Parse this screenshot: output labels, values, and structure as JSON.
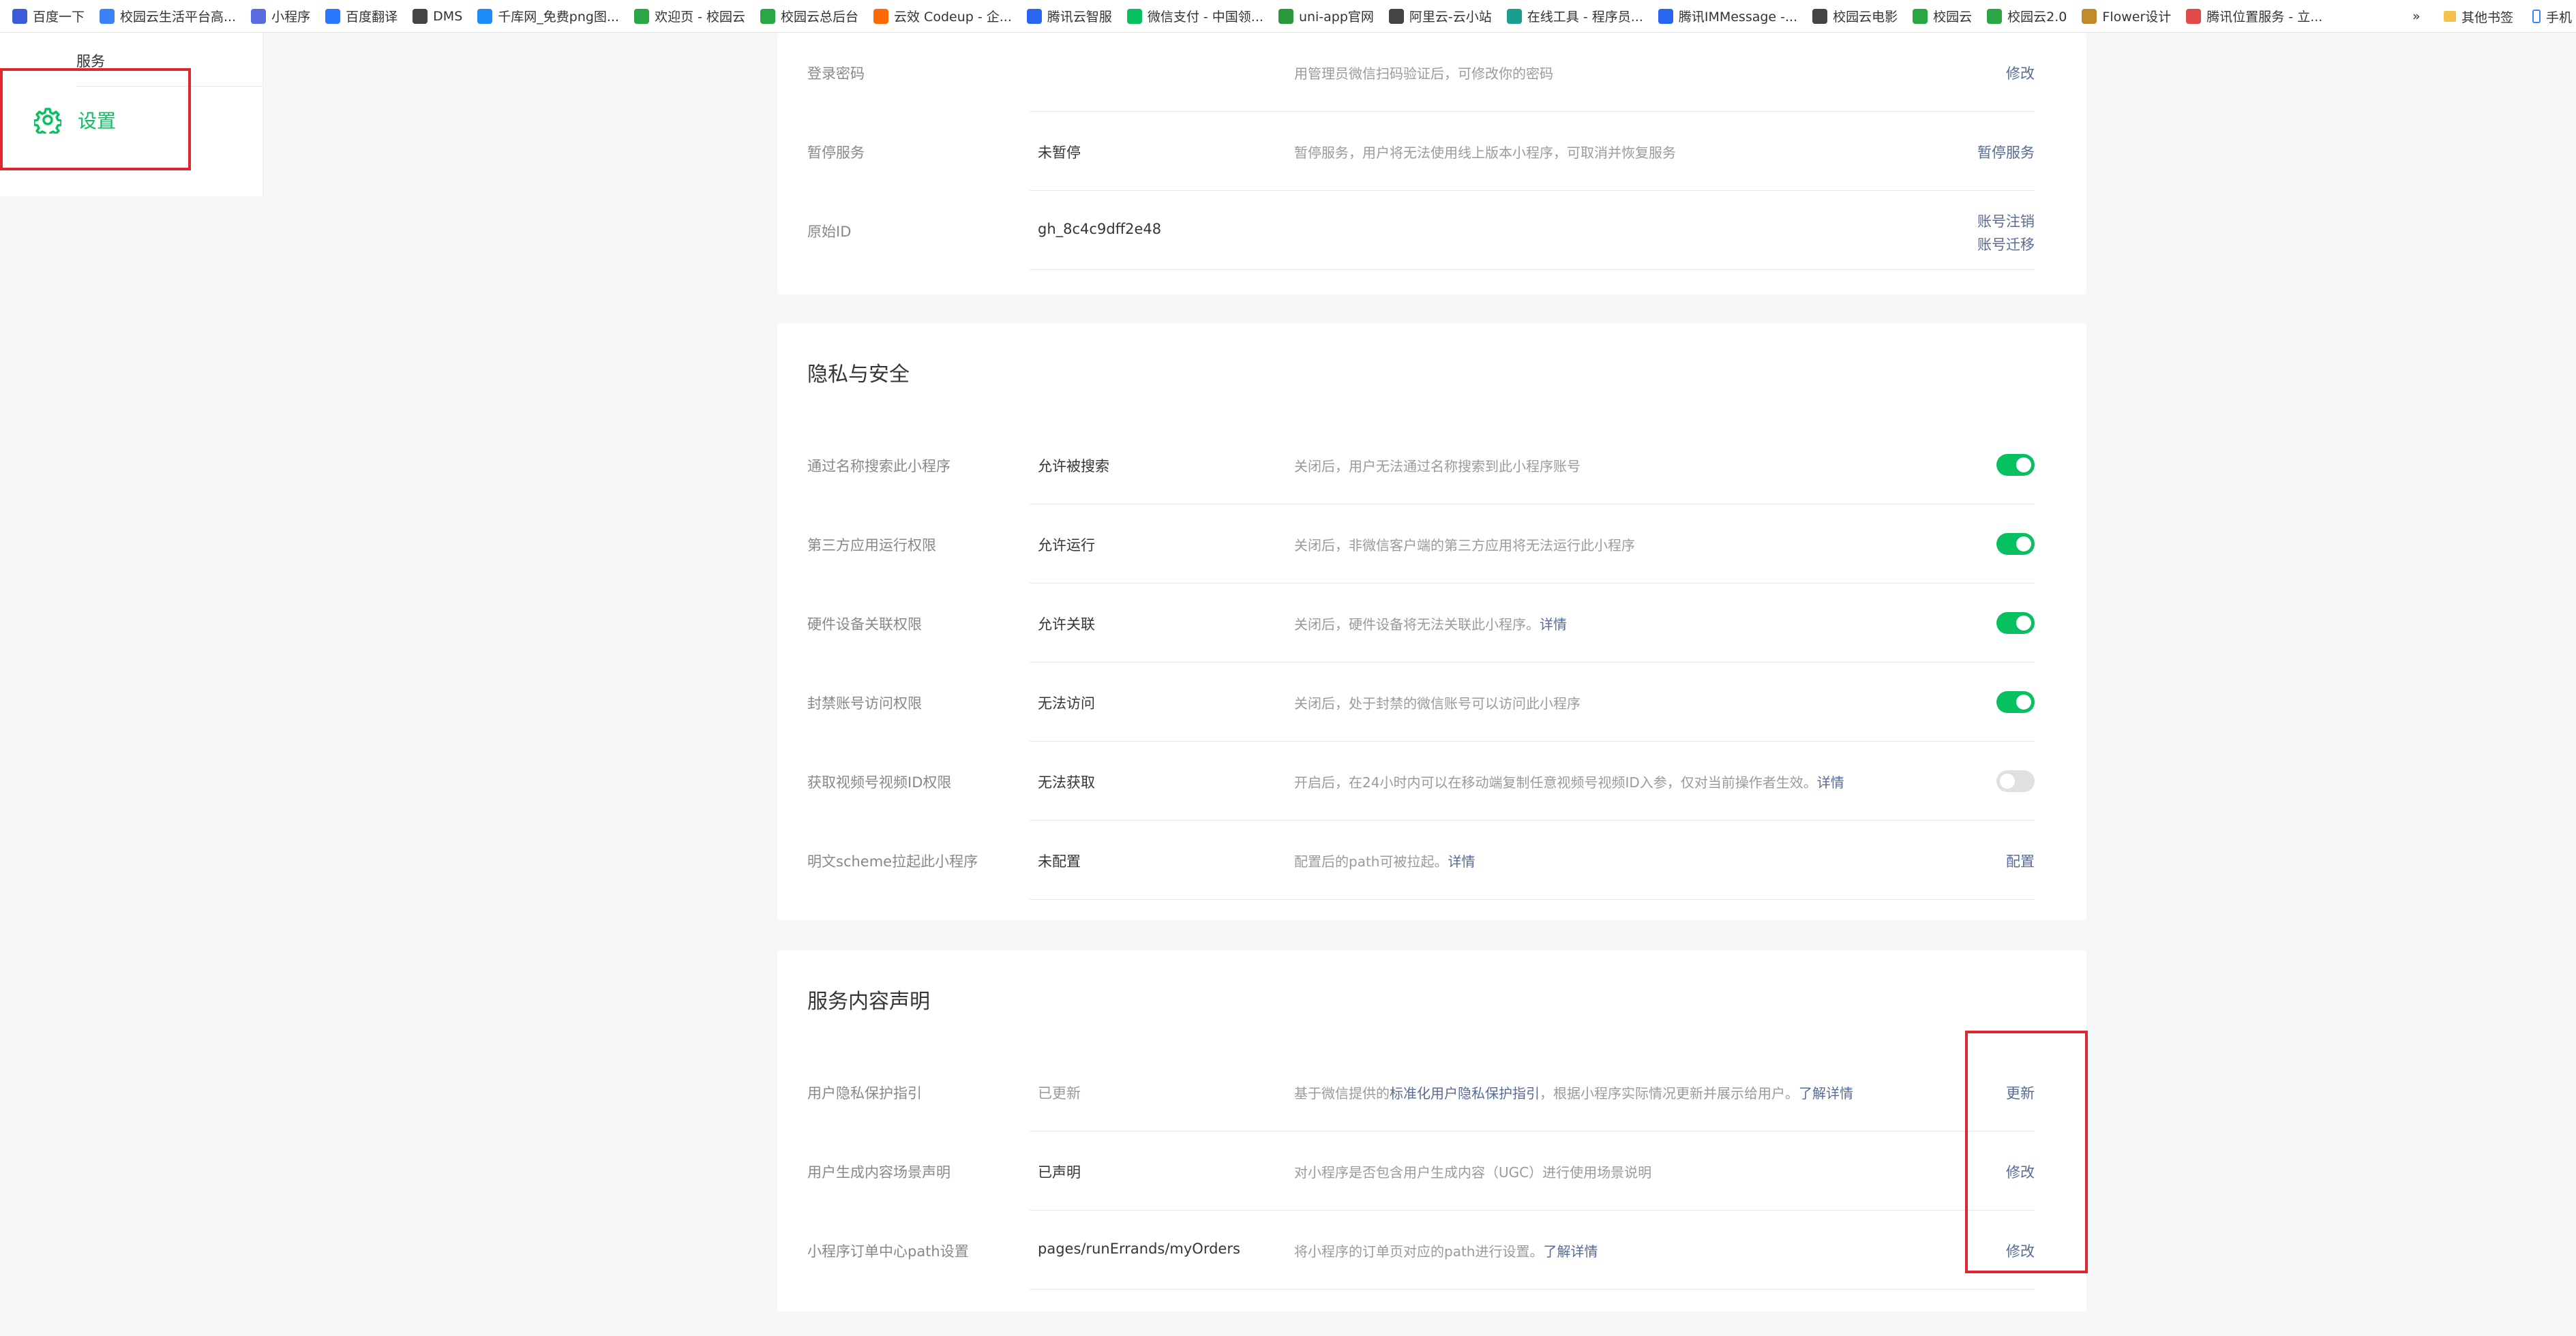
{
  "bookmarks": {
    "items": [
      {
        "label": "百度一下",
        "color": "#3d5cd8"
      },
      {
        "label": "校园云生活平台高...",
        "color": "#3b82f6"
      },
      {
        "label": "小程序",
        "color": "#5a6be0"
      },
      {
        "label": "百度翻译",
        "color": "#2b77ff"
      },
      {
        "label": "DMS",
        "color": "#444444"
      },
      {
        "label": "千库网_免费png图...",
        "color": "#1d8cf8"
      },
      {
        "label": "欢迎页 - 校园云",
        "color": "#2aa744"
      },
      {
        "label": "校园云总后台",
        "color": "#2aa744"
      },
      {
        "label": "云效 Codeup - 企...",
        "color": "#ff6a00"
      },
      {
        "label": "腾讯云智服",
        "color": "#2a65f0"
      },
      {
        "label": "微信支付 - 中国领...",
        "color": "#07c160"
      },
      {
        "label": "uni-app官网",
        "color": "#2b9939"
      },
      {
        "label": "阿里云-云小站",
        "color": "#444444"
      },
      {
        "label": "在线工具 - 程序员...",
        "color": "#1a9e8f"
      },
      {
        "label": "腾讯IMMessage -...",
        "color": "#2a65f0"
      },
      {
        "label": "校园云电影",
        "color": "#444444"
      },
      {
        "label": "校园云",
        "color": "#2aa744"
      },
      {
        "label": "校园云2.0",
        "color": "#2aa744"
      },
      {
        "label": "Flower设计",
        "color": "#c28a2b"
      },
      {
        "label": "腾讯位置服务 - 立...",
        "color": "#e24a4a"
      }
    ],
    "overflow": "»",
    "other_bookmarks": "其他书签",
    "mobile_bookmarks": "手机"
  },
  "sidebar": {
    "group_label": "服务",
    "active_item": "设置"
  },
  "account_section": {
    "rows": [
      {
        "label": "登录密码",
        "value": "",
        "desc": "用管理员微信扫码验证后，可修改你的密码",
        "action": "修改"
      },
      {
        "label": "暂停服务",
        "value": "未暂停",
        "desc": "暂停服务，用户将无法使用线上版本小程序，可取消并恢复服务",
        "action": "暂停服务"
      },
      {
        "label": "原始ID",
        "value": "gh_8c4c9dff2e48",
        "desc": "",
        "action": "账号注销",
        "action2": "账号迁移"
      }
    ]
  },
  "privacy_section": {
    "title": "隐私与安全",
    "rows": [
      {
        "label": "通过名称搜索此小程序",
        "value": "允许被搜索",
        "desc": "关闭后，用户无法通过名称搜索到此小程序账号",
        "link": "",
        "toggle": true
      },
      {
        "label": "第三方应用运行权限",
        "value": "允许运行",
        "desc": "关闭后，非微信客户端的第三方应用将无法运行此小程序",
        "link": "",
        "toggle": true
      },
      {
        "label": "硬件设备关联权限",
        "value": "允许关联",
        "desc": "关闭后，硬件设备将无法关联此小程序。",
        "link": "详情",
        "toggle": true
      },
      {
        "label": "封禁账号访问权限",
        "value": "无法访问",
        "desc": "关闭后，处于封禁的微信账号可以访问此小程序",
        "link": "",
        "toggle": true
      },
      {
        "label": "获取视频号视频ID权限",
        "value": "无法获取",
        "desc": "开启后，在24小时内可以在移动端复制任意视频号视频ID入参，仅对当前操作者生效。",
        "link": "详情",
        "toggle": false
      },
      {
        "label": "明文scheme拉起此小程序",
        "value": "未配置",
        "desc": "配置后的path可被拉起。",
        "link": "详情",
        "action": "配置"
      }
    ]
  },
  "declaration_section": {
    "title": "服务内容声明",
    "rows": [
      {
        "label": "用户隐私保护指引",
        "value": "已更新",
        "desc_pre": "基于微信提供的",
        "desc_link": "标准化用户隐私保护指引",
        "desc_post": "，根据小程序实际情况更新并展示给用户。",
        "link": "了解详情",
        "action": "更新"
      },
      {
        "label": "用户生成内容场景声明",
        "value": "已声明",
        "desc": "对小程序是否包含用户生成内容（UGC）进行使用场景说明",
        "action": "修改"
      },
      {
        "label": "小程序订单中心path设置",
        "value": "pages/runErrands/myOrders",
        "desc": "将小程序的订单页对应的path进行设置。",
        "link": "了解详情",
        "action": "修改"
      }
    ]
  },
  "colors": {
    "accent": "#07c160",
    "link": "#576b95",
    "highlight": "#e0262f"
  }
}
